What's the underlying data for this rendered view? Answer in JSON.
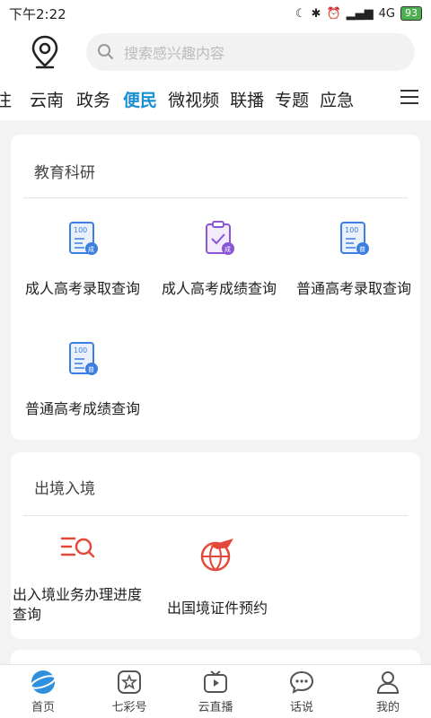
{
  "status": {
    "time": "下午2:22",
    "network": "4G",
    "battery": "93"
  },
  "search": {
    "placeholder": "搜索感兴趣内容"
  },
  "tabs": [
    "注",
    "云南",
    "政务",
    "便民",
    "微视频",
    "联播",
    "专题",
    "应急"
  ],
  "active_tab": "便民",
  "sections": {
    "education": {
      "title": "教育科研",
      "items": [
        "成人高考录取查询",
        "成人高考成绩查询",
        "普通高考录取查询",
        "普通高考成绩查询"
      ]
    },
    "immigration": {
      "title": "出境入境",
      "items": [
        "出入境业务办理进度查询",
        "出国境证件预约"
      ]
    }
  },
  "bottom_nav": [
    "首页",
    "七彩号",
    "云直播",
    "话说",
    "我的"
  ],
  "colors": {
    "accent": "#1a8fd1",
    "icon_blue": "#3b7fe0",
    "icon_purple": "#8a55d6",
    "icon_red": "#e3493a"
  }
}
